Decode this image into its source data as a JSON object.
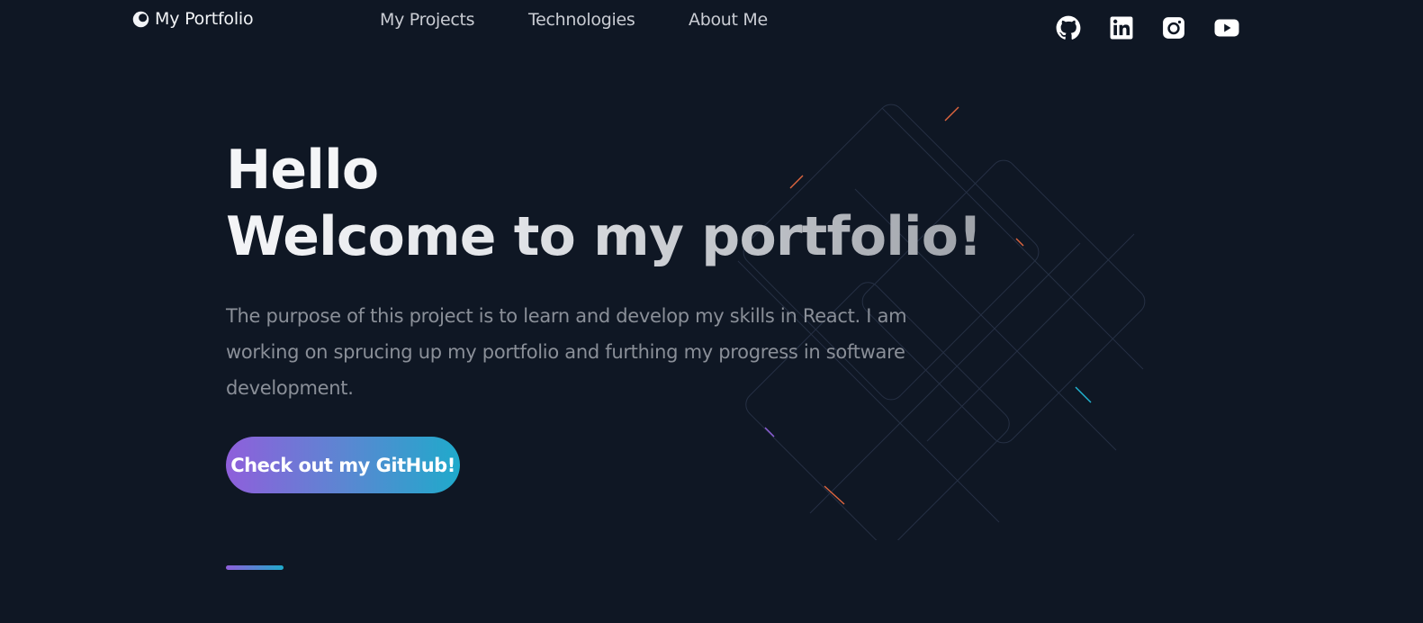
{
  "nav": {
    "brand": "My Portfolio",
    "links": [
      {
        "label": "My Projects"
      },
      {
        "label": "Technologies"
      },
      {
        "label": "About Me"
      }
    ],
    "socials": [
      "github-icon",
      "linkedin-icon",
      "instagram-icon",
      "youtube-icon"
    ]
  },
  "hero": {
    "title_line1": "Hello",
    "title_line2": "Welcome to my portfolio!",
    "description": "The purpose of this project is to learn and develop my skills in React. I am working on sprucing up my portfolio and furthing my progress in software development.",
    "cta_label": "Check out my GitHub!"
  },
  "colors": {
    "background": "#0f1724",
    "gradient_start": "#8f5fdb",
    "gradient_end": "#1faacb",
    "text_primary": "#f4f5f7",
    "text_muted": "#8a8f98"
  }
}
